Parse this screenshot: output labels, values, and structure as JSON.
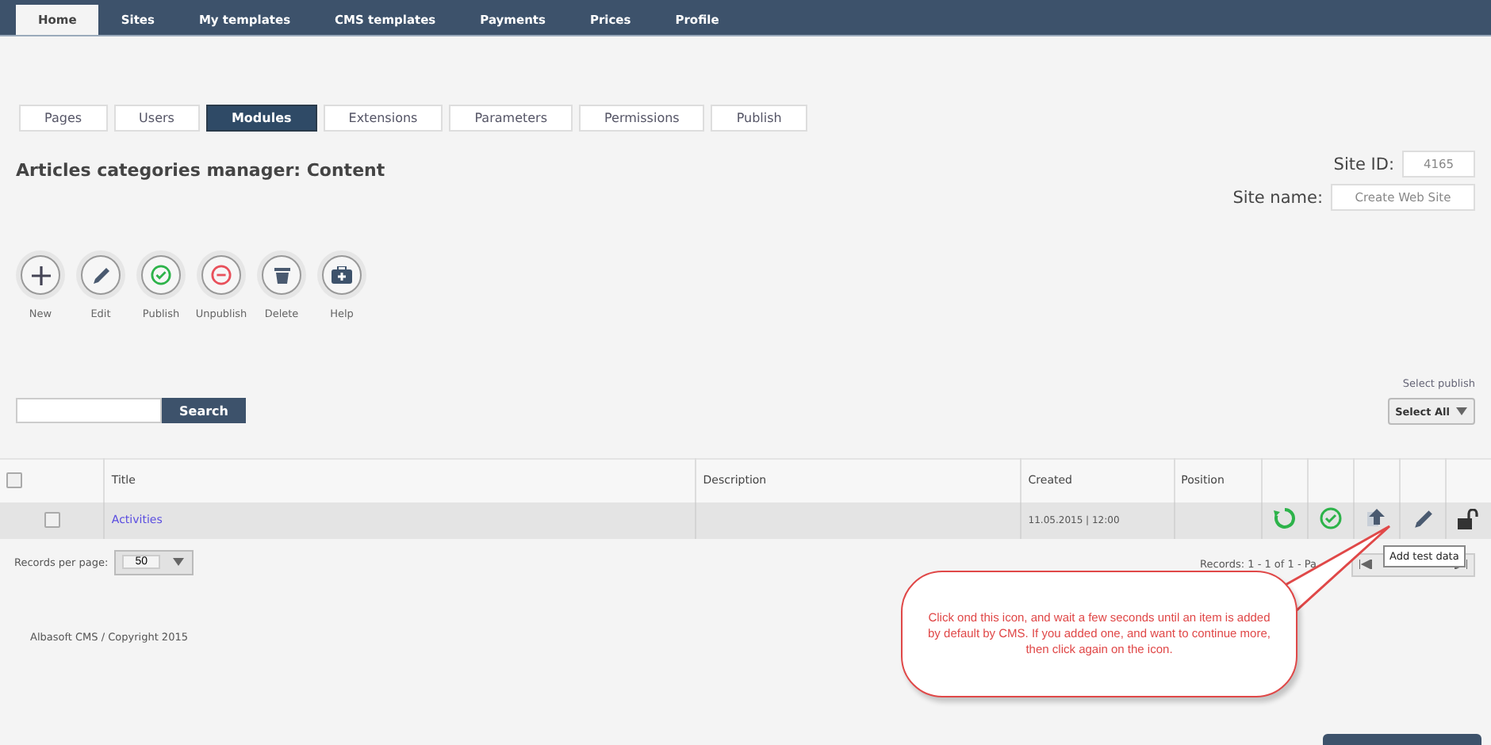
{
  "top_nav": [
    {
      "label": "Home",
      "selected": true
    },
    {
      "label": "Sites",
      "selected": false
    },
    {
      "label": "My templates",
      "selected": false
    },
    {
      "label": "CMS templates",
      "selected": false
    },
    {
      "label": "Payments",
      "selected": false
    },
    {
      "label": "Prices",
      "selected": false
    },
    {
      "label": "Profile",
      "selected": false
    }
  ],
  "tabs": [
    {
      "label": "Pages",
      "selected": false
    },
    {
      "label": "Users",
      "selected": false
    },
    {
      "label": "Modules",
      "selected": true
    },
    {
      "label": "Extensions",
      "selected": false
    },
    {
      "label": "Parameters",
      "selected": false
    },
    {
      "label": "Permissions",
      "selected": false
    },
    {
      "label": "Publish",
      "selected": false
    }
  ],
  "heading": "Articles categories manager: Content",
  "site_info": {
    "id_label": "Site ID:",
    "id_value": "4165",
    "name_label": "Site name:",
    "name_value": "Create Web Site"
  },
  "toolbar": [
    {
      "kind": "new",
      "label": "New"
    },
    {
      "kind": "edit",
      "label": "Edit"
    },
    {
      "kind": "publish",
      "label": "Publish"
    },
    {
      "kind": "unpublish",
      "label": "Unpublish"
    },
    {
      "kind": "delete",
      "label": "Delete"
    },
    {
      "kind": "help",
      "label": "Help"
    }
  ],
  "search": {
    "button": "Search"
  },
  "select_publish": {
    "label": "Select publish",
    "value": "Select All"
  },
  "table": {
    "header_checked": false,
    "columns": [
      "Title",
      "Description",
      "Created",
      "Position"
    ],
    "rows": [
      {
        "checked": false,
        "title": "Activities",
        "created": "11.05.2015 | 12:00",
        "actions": [
          {
            "kind": "refresh"
          },
          {
            "kind": "publish"
          },
          {
            "kind": "add"
          },
          {
            "kind": "edit"
          },
          {
            "kind": "unlock"
          }
        ]
      }
    ]
  },
  "pager": {
    "per_page_label": "Records per page:",
    "per_page": "50",
    "records": "Records: 1 - 1 of 1 - Pa"
  },
  "tooltip": "Add test data",
  "callout": "Click ond this icon, and wait a few seconds until an item is added by default by CMS. If you added one, and want to continue more, then click again on the icon.",
  "footer": "Albasoft CMS / Copyright 2015"
}
